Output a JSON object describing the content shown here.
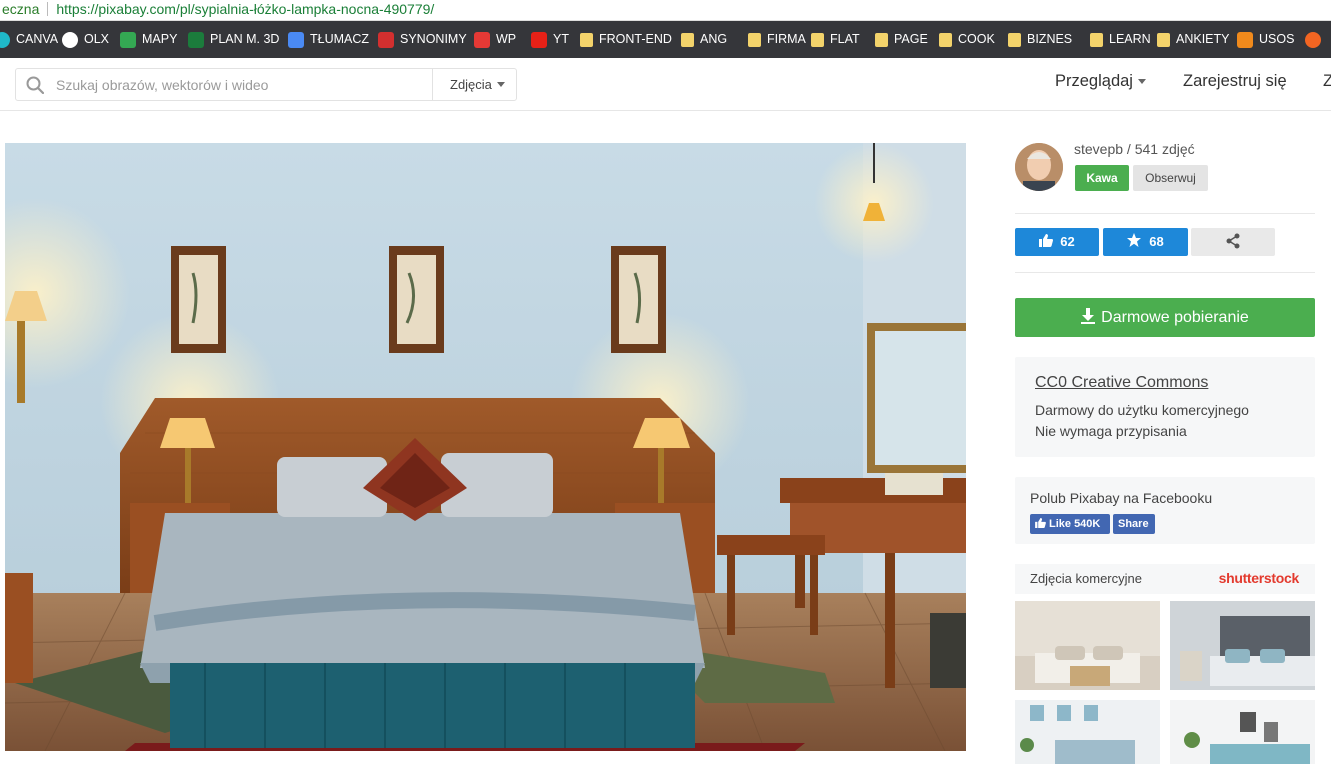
{
  "address_bar": {
    "security_fragment": "eczna",
    "url": "https://pixabay.com/pl/sypialnia-łóżko-lampka-nocna-490779/"
  },
  "bookmarks": [
    {
      "label": "CANVA",
      "icon": "canva-icon",
      "color": "#1fb9c9"
    },
    {
      "label": "OLX",
      "icon": "olx-icon",
      "color": "#ffffff"
    },
    {
      "label": "MAPY",
      "icon": "google-maps-icon",
      "color": "#34a853"
    },
    {
      "label": "PLAN M. 3D",
      "icon": "planner-icon",
      "color": "#1b7c3c"
    },
    {
      "label": "TŁUMACZ",
      "icon": "google-translate-icon",
      "color": "#4a8af4"
    },
    {
      "label": "SYNONIMY",
      "icon": "synonimy-icon",
      "color": "#d32f2f"
    },
    {
      "label": "WP",
      "icon": "wp-icon",
      "color": "#e53935"
    },
    {
      "label": "YT",
      "icon": "youtube-icon",
      "color": "#e62117"
    },
    {
      "label": "FRONT-END",
      "icon": "folder-icon",
      "color": "#f3d36b"
    },
    {
      "label": "ANG",
      "icon": "folder-icon",
      "color": "#f3d36b"
    },
    {
      "label": "FIRMA",
      "icon": "folder-icon",
      "color": "#f3d36b"
    },
    {
      "label": "FLAT",
      "icon": "folder-icon",
      "color": "#f3d36b"
    },
    {
      "label": "PAGE",
      "icon": "folder-icon",
      "color": "#f3d36b"
    },
    {
      "label": "COOK",
      "icon": "folder-icon",
      "color": "#f3d36b"
    },
    {
      "label": "BIZNES",
      "icon": "folder-icon",
      "color": "#f3d36b"
    },
    {
      "label": "LEARN",
      "icon": "folder-icon",
      "color": "#f3d36b"
    },
    {
      "label": "ANKIETY",
      "icon": "folder-icon",
      "color": "#f3d36b"
    },
    {
      "label": "USOS",
      "icon": "usos-icon",
      "color": "#f08a1c"
    },
    {
      "label": "",
      "icon": "shield-icon",
      "color": "#f26522"
    }
  ],
  "header": {
    "search_placeholder": "Szukaj obrazów, wektorów i wideo",
    "type_select": "Zdjęcia",
    "nav_browse": "Przeglądaj",
    "nav_register": "Zarejestruj się",
    "nav_clipped": "Z"
  },
  "author": {
    "name": "stevepb",
    "separator": " / ",
    "count": "541 zdjęć",
    "coffee_button": "Kawa",
    "follow_button": "Obserwuj"
  },
  "actions": {
    "likes": "62",
    "favorites": "68"
  },
  "download": {
    "label": "Darmowe pobieranie"
  },
  "license": {
    "title": "CC0 Creative Commons",
    "line1": "Darmowy do użytku komercyjnego",
    "line2": "Nie wymaga przypisania"
  },
  "facebook": {
    "title": "Polub Pixabay na Facebooku",
    "like_label": "Like 540K",
    "share_label": "Share"
  },
  "commercial": {
    "title": "Zdjęcia komercyjne",
    "brand": "shutterstock"
  },
  "colors": {
    "green": "#4bae4f",
    "blue": "#1e88d9",
    "bookmark_bar": "#35363a",
    "facebook": "#4267b2"
  }
}
